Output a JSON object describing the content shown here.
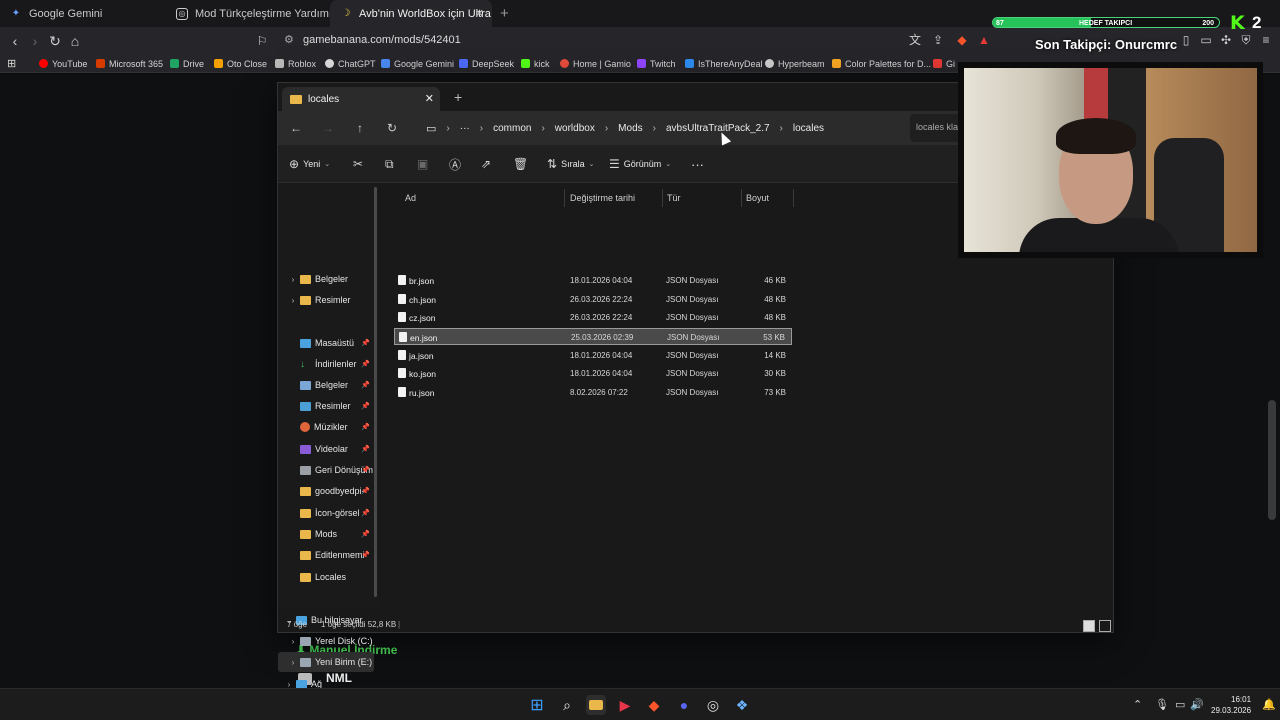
{
  "browser": {
    "tabs": [
      {
        "title": "Google Gemini",
        "icon": "gemini-icon"
      },
      {
        "title": "Mod Türkçeleştirme Yardımı",
        "icon": "chat-icon"
      },
      {
        "title": "Avb'nin WorldBox için Ultra Özel",
        "icon": "banana-icon"
      }
    ],
    "url": "gamebanana.com/mods/542401",
    "bookmarks": [
      {
        "label": "YouTube",
        "color": "#ff0000"
      },
      {
        "label": "Microsoft 365",
        "color": "#d83b01"
      },
      {
        "label": "Drive",
        "color": "#1fa463"
      },
      {
        "label": "Oto Close",
        "color": "#f4a000"
      },
      {
        "label": "Roblox",
        "color": "#bbbbbb"
      },
      {
        "label": "ChatGPT",
        "color": "#dddddd"
      },
      {
        "label": "Google Gemini",
        "color": "#4a8af4"
      },
      {
        "label": "DeepSeek",
        "color": "#4d6bfe"
      },
      {
        "label": "kick",
        "color": "#53fc18"
      },
      {
        "label": "Home | Gamio",
        "color": "#e74c3c"
      },
      {
        "label": "Twitch",
        "color": "#9146ff"
      },
      {
        "label": "IsThereAnyDeal",
        "color": "#2d8cf0"
      },
      {
        "label": "Hyperbeam",
        "color": "#cccccc"
      },
      {
        "label": "Color Palettes for D...",
        "color": "#f5a623"
      },
      {
        "label": "Gi",
        "color": "#e53935"
      }
    ]
  },
  "overlay": {
    "left_value": "87",
    "goal_label": "HEDEF TAKIPCI",
    "goal_value": "200",
    "progress": 0.435,
    "kick_count": "2",
    "last_follower": "Son Takipçi: Onurcmrc"
  },
  "explorer": {
    "tab_title": "locales",
    "breadcrumbs": [
      "common",
      "worldbox",
      "Mods",
      "avbsUltraTraitPack_2.7",
      "locales"
    ],
    "search_placeholder": "locales klasöründe ara",
    "toolbar": {
      "new": "Yeni",
      "sort": "Sırala",
      "view": "Görünüm"
    },
    "sidebar": [
      {
        "label": "Belgeler",
        "type": "folder",
        "chevron": true
      },
      {
        "label": "Resimler",
        "type": "folder",
        "chevron": true
      },
      {
        "label": "Masaüstü",
        "type": "desktop",
        "pinned": true
      },
      {
        "label": "İndirilenler",
        "type": "download",
        "pinned": true
      },
      {
        "label": "Belgeler",
        "type": "docs",
        "pinned": true
      },
      {
        "label": "Resimler",
        "type": "pictures",
        "pinned": true
      },
      {
        "label": "Müzikler",
        "type": "music",
        "pinned": true
      },
      {
        "label": "Videolar",
        "type": "video",
        "pinned": true
      },
      {
        "label": "Geri Dönüşüm",
        "type": "recycle",
        "pinned": true
      },
      {
        "label": "goodbyedpi-",
        "type": "folder",
        "pinned": true
      },
      {
        "label": "İcon-görsel",
        "type": "folder",
        "pinned": true
      },
      {
        "label": "Mods",
        "type": "folder",
        "pinned": true
      },
      {
        "label": "Editlenmemi",
        "type": "folder",
        "pinned": true
      },
      {
        "label": "Locales",
        "type": "folder"
      },
      {
        "label": "Bu bilgisayar",
        "type": "pc",
        "chevron": true
      },
      {
        "label": "Yerel Disk (C:)",
        "type": "drive",
        "chevron": true
      },
      {
        "label": "Yeni Birim (E:)",
        "type": "drive",
        "chevron": true,
        "selected": true
      },
      {
        "label": "Ağ",
        "type": "network",
        "chevron": true
      }
    ],
    "columns": {
      "name": "Ad",
      "modified": "Değiştirme tarihi",
      "type": "Tür",
      "size": "Boyut"
    },
    "files": [
      {
        "name": "br.json",
        "modified": "18.01.2026 04:04",
        "type": "JSON Dosyası",
        "size": "46 KB"
      },
      {
        "name": "ch.json",
        "modified": "26.03.2026 22:24",
        "type": "JSON Dosyası",
        "size": "48 KB"
      },
      {
        "name": "cz.json",
        "modified": "26.03.2026 22:24",
        "type": "JSON Dosyası",
        "size": "48 KB"
      },
      {
        "name": "en.json",
        "modified": "25.03.2026 02:39",
        "type": "JSON Dosyası",
        "size": "53 KB",
        "selected": true
      },
      {
        "name": "ja.json",
        "modified": "18.01.2026 04:04",
        "type": "JSON Dosyası",
        "size": "14 KB"
      },
      {
        "name": "ko.json",
        "modified": "18.01.2026 04:04",
        "type": "JSON Dosyası",
        "size": "30 KB"
      },
      {
        "name": "ru.json",
        "modified": "8.02.2026 07:22",
        "type": "JSON Dosyası",
        "size": "73 KB"
      }
    ],
    "status": {
      "count": "7 öğe",
      "selection": "1 öğe seçildi  52,8 KB"
    }
  },
  "webpage": {
    "download_label": "Manuel İndirme",
    "nml_label": "NML"
  },
  "taskbar": {
    "time": "16:01",
    "date": "29.03.2026"
  }
}
